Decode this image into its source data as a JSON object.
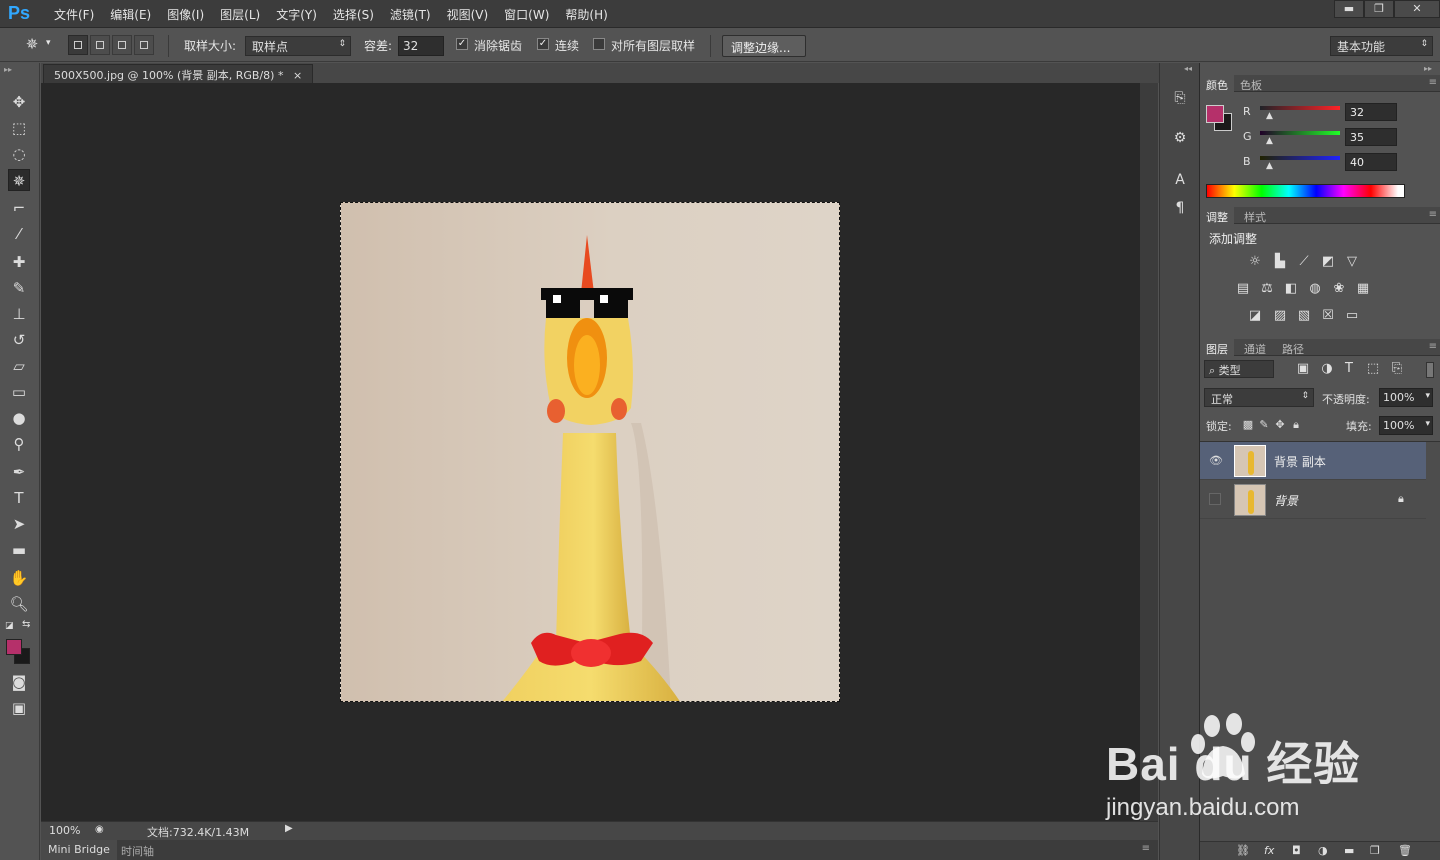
{
  "app": {
    "logo": "Ps"
  },
  "menu": [
    "文件(F)",
    "编辑(E)",
    "图像(I)",
    "图层(L)",
    "文字(Y)",
    "选择(S)",
    "滤镜(T)",
    "视图(V)",
    "窗口(W)",
    "帮助(H)"
  ],
  "window_controls": {
    "minimize": "▬",
    "restore": "❐",
    "close": "✕"
  },
  "options": {
    "sample_size_label": "取样大小:",
    "sample_size_value": "取样点",
    "tolerance_label": "容差:",
    "tolerance_value": "32",
    "anti_alias_label": "消除锯齿",
    "anti_alias_checked": true,
    "contiguous_label": "连续",
    "contiguous_checked": true,
    "sample_all_label": "对所有图层取样",
    "sample_all_checked": false,
    "refine_edge_label": "调整边缘...",
    "workspace": "基本功能"
  },
  "document": {
    "tab_title": "500X500.jpg @ 100% (背景 副本, RGB/8) *",
    "tab_close": "×"
  },
  "status": {
    "zoom": "100%",
    "doc_info": "文档:732.4K/1.43M"
  },
  "bottom_tabs": [
    "Mini Bridge",
    "时间轴"
  ],
  "colors_panel": {
    "tabs": [
      "颜色",
      "色板"
    ],
    "r_label": "R",
    "r_value": "32",
    "g_label": "G",
    "g_value": "35",
    "b_label": "B",
    "b_value": "40",
    "foreground": "#b5306a",
    "background": "#1a1a1a"
  },
  "adjustments_panel": {
    "tabs": [
      "调整",
      "样式"
    ],
    "title": "添加调整"
  },
  "layers_panel": {
    "tabs": [
      "图层",
      "通道",
      "路径"
    ],
    "filter_kind": "类型",
    "blend_mode": "正常",
    "opacity_label": "不透明度:",
    "opacity_value": "100%",
    "lock_label": "锁定:",
    "fill_label": "填充:",
    "fill_value": "100%",
    "layers": [
      {
        "name": "背景 副本",
        "visible": true,
        "selected": true
      },
      {
        "name": "背景",
        "visible": false,
        "selected": false,
        "locked": true
      }
    ]
  },
  "watermark": {
    "brand": "Bai du 经验",
    "url": "jingyan.baidu.com"
  }
}
